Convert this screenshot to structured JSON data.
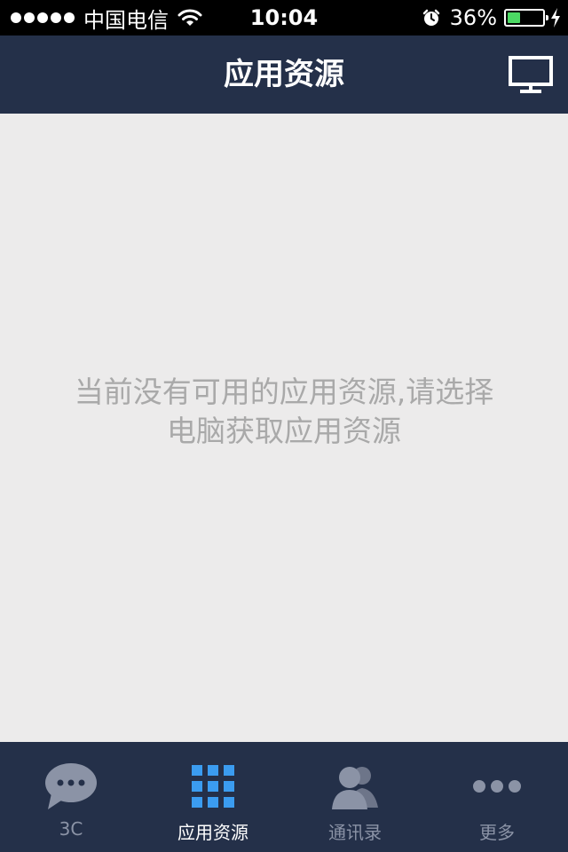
{
  "status_bar": {
    "carrier": "中国电信",
    "time": "10:04",
    "battery_percent": "36%",
    "battery_level": 0.36,
    "icons": [
      "signal-dots-icon",
      "wifi-icon",
      "alarm-icon",
      "battery-icon",
      "charging-bolt-icon"
    ]
  },
  "nav": {
    "title": "应用资源",
    "right_icon": "monitor-icon"
  },
  "content": {
    "empty_line1": "当前没有可用的应用资源,请选择",
    "empty_line2": "电脑获取应用资源"
  },
  "tabs": [
    {
      "label": "3C",
      "icon": "chat-bubble-icon",
      "active": false
    },
    {
      "label": "应用资源",
      "icon": "grid-icon",
      "active": true
    },
    {
      "label": "通讯录",
      "icon": "contacts-icon",
      "active": false
    },
    {
      "label": "更多",
      "icon": "more-dots-icon",
      "active": false
    }
  ],
  "colors": {
    "nav_background": "#243049",
    "content_background": "#ecebeb",
    "message_text": "#a9a9a9",
    "active_icon": "#3b9cf0",
    "inactive_icon": "#8b93a6",
    "battery_fill": "#4cd964"
  }
}
